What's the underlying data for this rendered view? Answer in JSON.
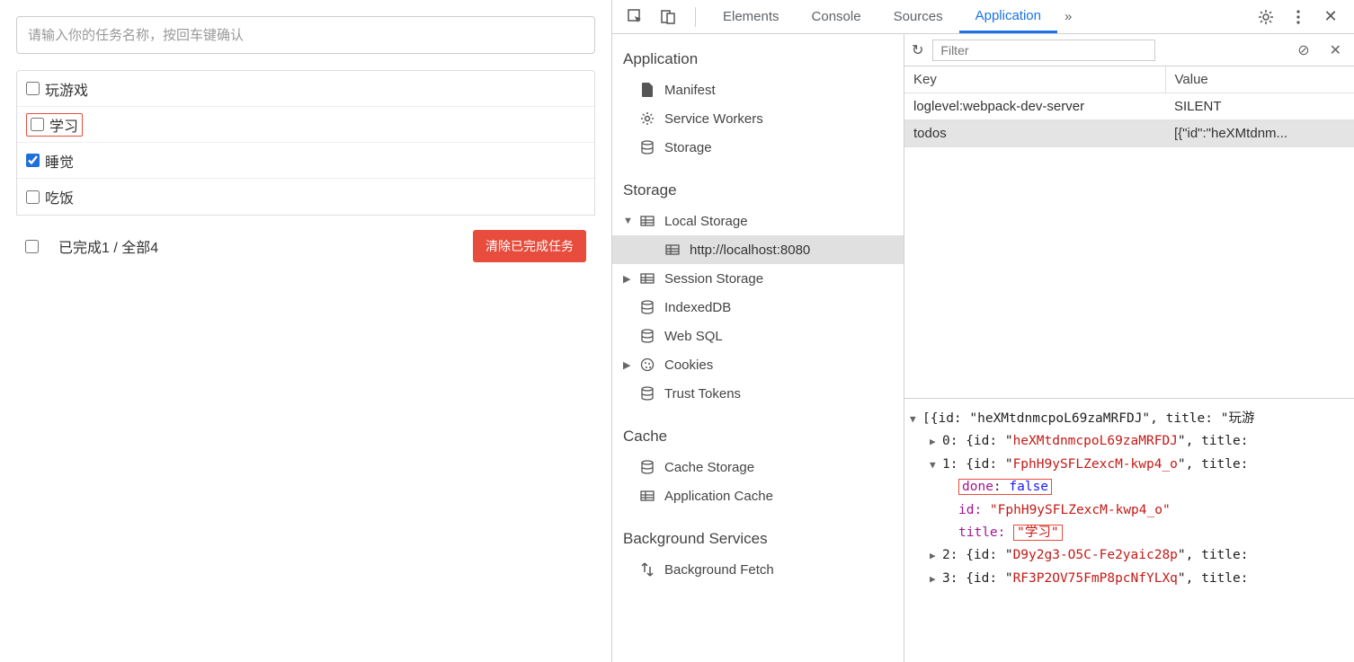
{
  "todo": {
    "placeholder": "请输入你的任务名称，按回车键确认",
    "items": [
      {
        "label": "玩游戏",
        "checked": false,
        "hl": false
      },
      {
        "label": "学习",
        "checked": false,
        "hl": true
      },
      {
        "label": "睡觉",
        "checked": true,
        "hl": false
      },
      {
        "label": "吃饭",
        "checked": false,
        "hl": false
      }
    ],
    "status": "已完成1 / 全部4",
    "clear_btn": "清除已完成任务"
  },
  "devtools": {
    "tabs": {
      "elements": "Elements",
      "console": "Console",
      "sources": "Sources",
      "application": "Application",
      "more": "»"
    },
    "sidebar": {
      "application": {
        "title": "Application",
        "manifest": "Manifest",
        "service_workers": "Service Workers",
        "storage": "Storage"
      },
      "storage": {
        "title": "Storage",
        "local_storage": "Local Storage",
        "local_storage_origin": "http://localhost:8080",
        "session_storage": "Session Storage",
        "indexeddb": "IndexedDB",
        "websql": "Web SQL",
        "cookies": "Cookies",
        "trust_tokens": "Trust Tokens"
      },
      "cache": {
        "title": "Cache",
        "cache_storage": "Cache Storage",
        "app_cache": "Application Cache"
      },
      "bg": {
        "title": "Background Services",
        "bg_fetch": "Background Fetch"
      }
    },
    "filter_placeholder": "Filter",
    "table": {
      "headers": {
        "key": "Key",
        "value": "Value"
      },
      "rows": [
        {
          "k": "loglevel:webpack-dev-server",
          "v": "SILENT",
          "selected": false
        },
        {
          "k": "todos",
          "v": "[{\"id\":\"heXMtdnm...",
          "selected": true
        }
      ]
    },
    "value_view": {
      "line0": "[{id: \"heXMtdnmcpoL69zaMRFDJ\", title: \"玩游",
      "line1_pre": "0: {id: \"",
      "id0": "heXMtdnmcpoL69zaMRFDJ",
      "line1_post": "\", title:",
      "line2_pre": "1: {id: \"",
      "id1": "FphH9ySFLZexcM-kwp4_o",
      "line2_post": "\", title:",
      "done_label": "done",
      "done_colon": ": ",
      "done_val": "false",
      "id_label": "id: ",
      "id1_q": "\"FphH9ySFLZexcM-kwp4_o\"",
      "title_label": "title: ",
      "title1_q": "\"学习\"",
      "line5_pre": "2: {id: \"",
      "id2": "D9y2g3-O5C-Fe2yaic28p",
      "line5_post": "\", title:",
      "line6_pre": "3: {id: \"",
      "id3": "RF3P2OV75FmP8pcNfYLXq",
      "line6_post": "\", title:"
    }
  }
}
